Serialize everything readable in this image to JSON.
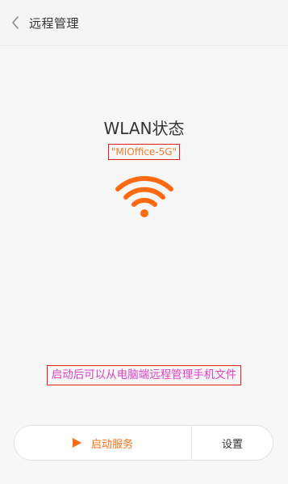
{
  "header": {
    "back_icon": "chevron-left-icon",
    "title": "远程管理"
  },
  "status": {
    "title": "WLAN状态",
    "ssid": "\"MIOffice-5G\"",
    "wifi_icon": "wifi-icon",
    "wifi_color": "#ff6a10"
  },
  "hint": {
    "text": "启动后可以从电脑端远程管理手机文件"
  },
  "actions": {
    "start_icon": "play-icon",
    "start_label": "启动服务",
    "settings_label": "设置"
  },
  "colors": {
    "accent": "#ff6a10",
    "annotation_border": "#e02020",
    "hint_text": "#e040c8"
  }
}
